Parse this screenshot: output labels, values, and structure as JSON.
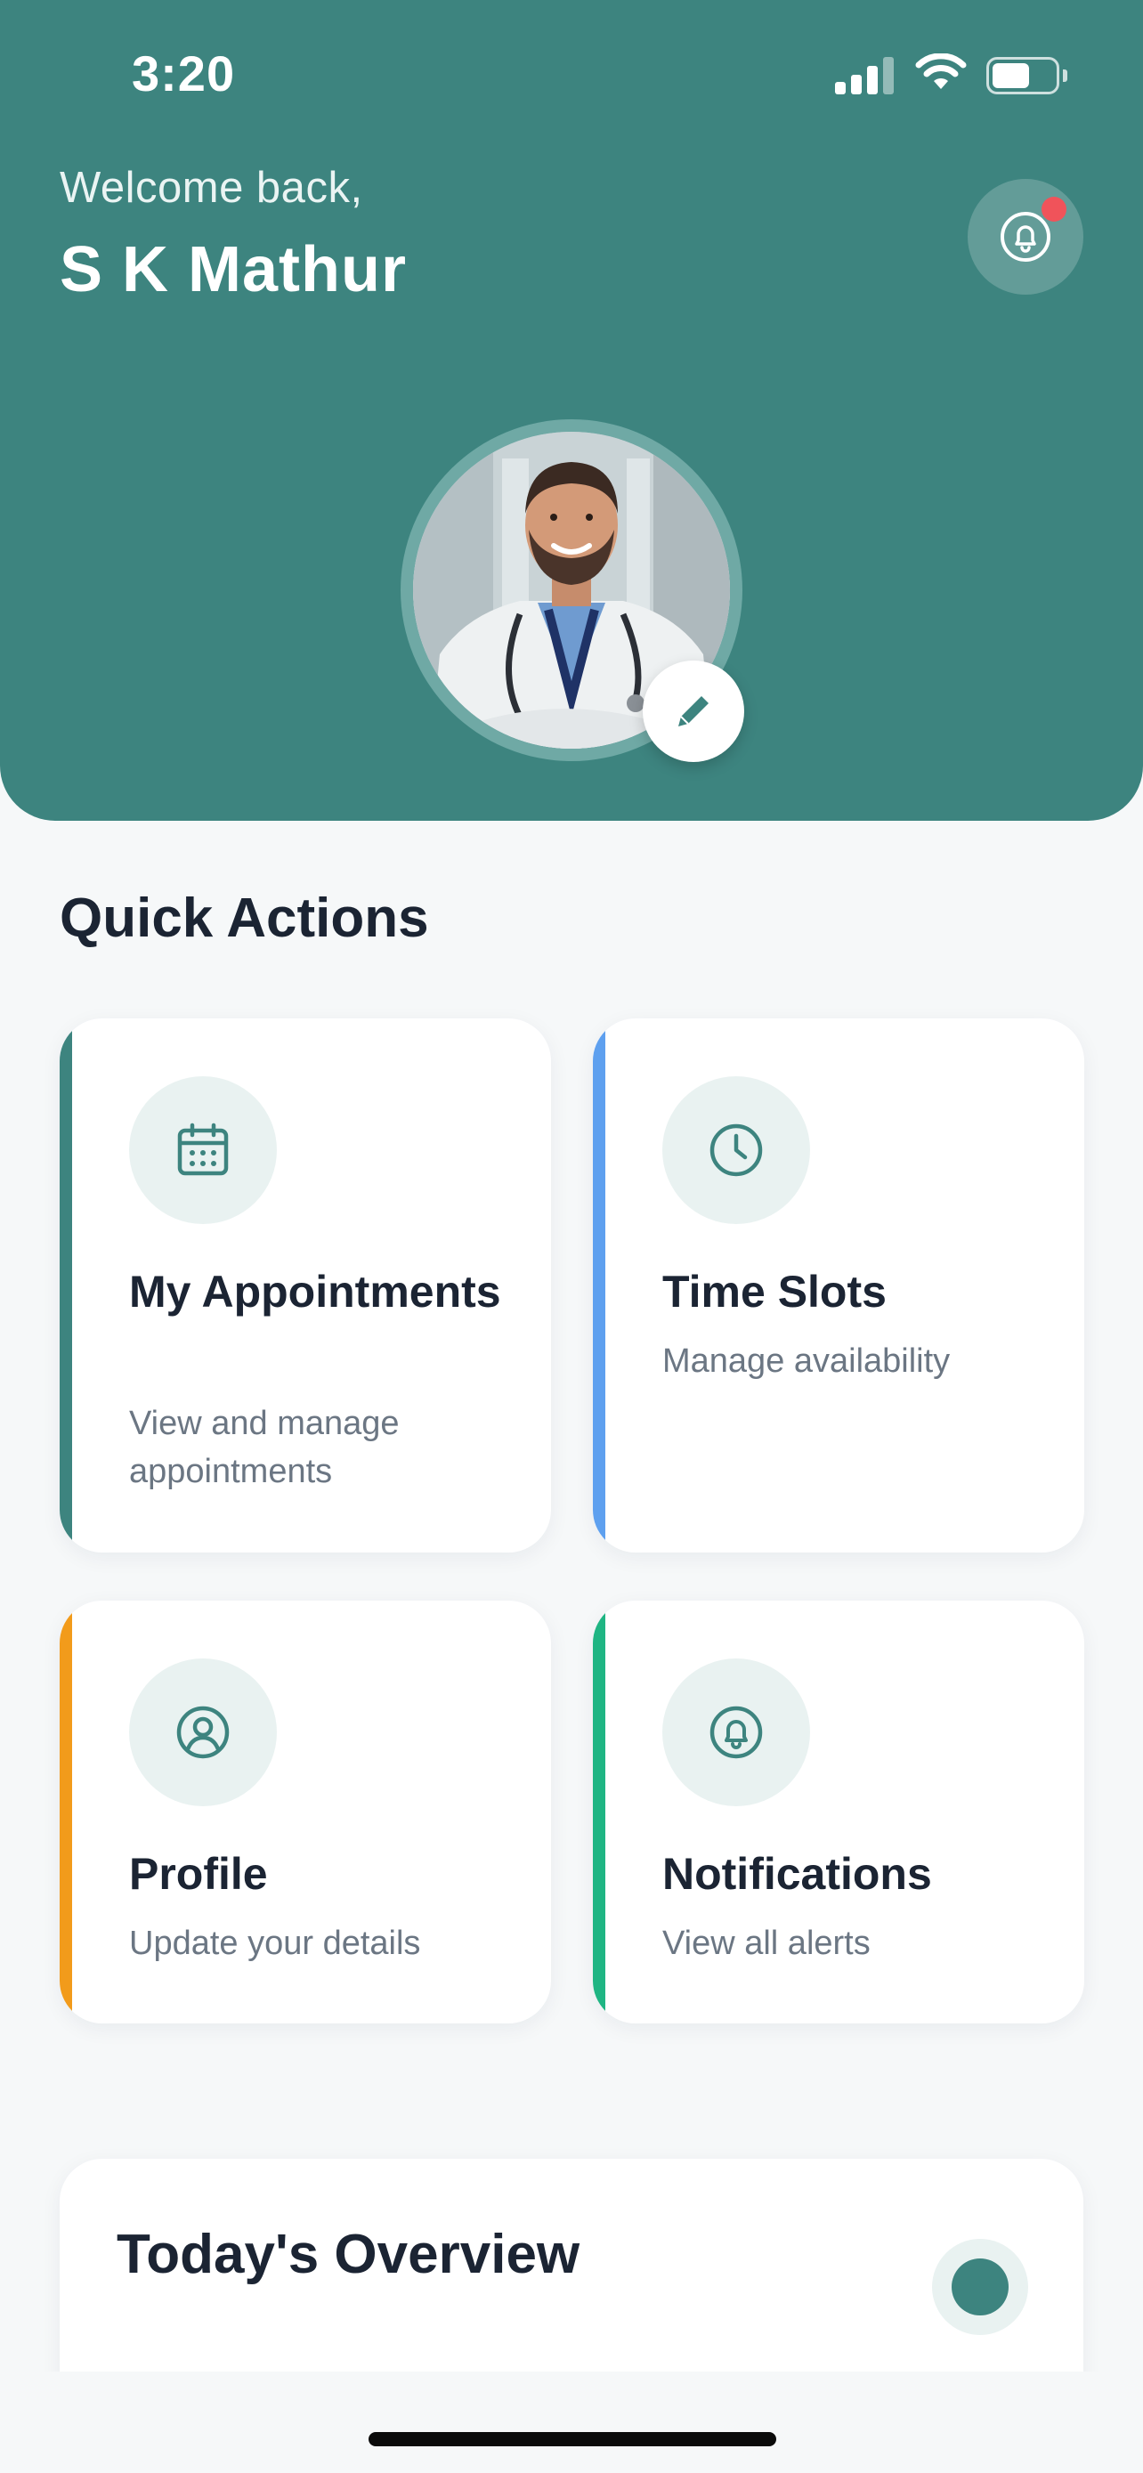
{
  "status_bar": {
    "time": "3:20",
    "signal_icon": "cellular-signal-icon",
    "wifi_icon": "wifi-icon",
    "battery_icon": "battery-icon",
    "battery_level": 0.6
  },
  "header": {
    "greeting": "Welcome back,",
    "user_name": "S K Mathur",
    "notification_icon": "bell-icon",
    "has_unread_notifications": true,
    "avatar": "doctor-profile-photo",
    "edit_icon": "pencil-icon"
  },
  "quick_actions": {
    "title": "Quick Actions",
    "cards": [
      {
        "title": "My Appointments",
        "description": "View and manage appointments",
        "icon": "calendar-icon",
        "accent": "#3d847f"
      },
      {
        "title": "Time Slots",
        "description": "Manage availability",
        "icon": "clock-icon",
        "accent": "#5ea0ef"
      },
      {
        "title": "Profile",
        "description": "Update your details",
        "icon": "user-circle-icon",
        "accent": "#f29b1b"
      },
      {
        "title": "Notifications",
        "description": "View all alerts",
        "icon": "bell-icon",
        "accent": "#1fb583"
      }
    ]
  },
  "overview": {
    "title": "Today's Overview"
  },
  "colors": {
    "primary": "#3d847f",
    "background": "#f6f8f9",
    "text": "#1b2433",
    "muted_text": "#6b7683",
    "notification_dot": "#f0535a"
  }
}
